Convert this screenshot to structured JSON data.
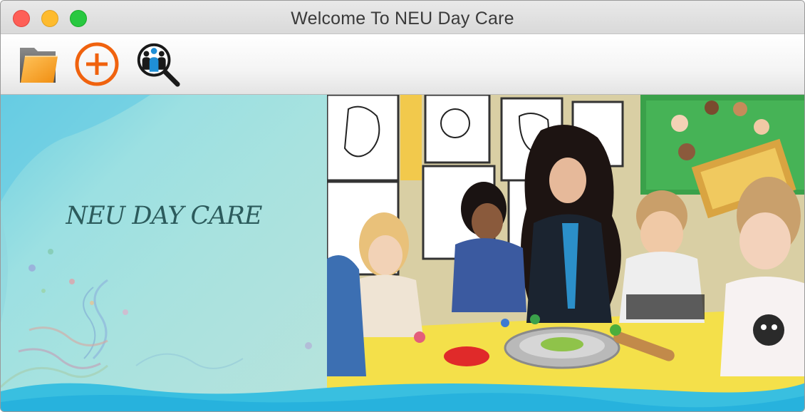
{
  "window": {
    "title": "Welcome To NEU Day Care",
    "controls": [
      "close",
      "minimize",
      "maximize"
    ]
  },
  "toolbar": {
    "buttons": [
      {
        "name": "open",
        "icon": "folder-icon"
      },
      {
        "name": "add",
        "icon": "plus-circle-icon"
      },
      {
        "name": "search",
        "icon": "people-search-icon"
      }
    ]
  },
  "main": {
    "brand_text": "NEU DAY CARE",
    "photo_subject": "classroom-photo"
  },
  "colors": {
    "close": "#fe5f57",
    "minimize": "#febb2e",
    "maximize": "#28c840",
    "add_accent": "#f0620e",
    "brand": "#2c5b5c",
    "panel": "#a8e2df"
  }
}
